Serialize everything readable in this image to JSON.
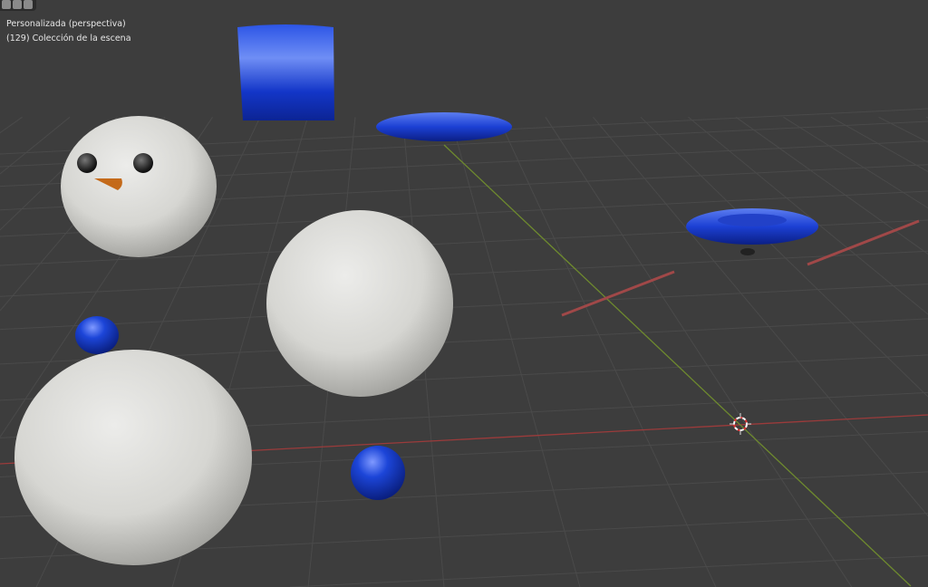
{
  "viewport": {
    "view_name": "Personalizada (perspectiva)",
    "collection_label": "(129) Colección de la escena"
  },
  "colors": {
    "background": "#3d3d3d",
    "x_axis": "#9b3b3b",
    "y_axis": "#6e8a2e",
    "blue_material": "#1a3fd0",
    "snow_material": "#e8e8e4"
  },
  "toolbar": {
    "icons": [
      "mode-select-icon",
      "face-select-icon",
      "vertex-select-icon"
    ]
  }
}
